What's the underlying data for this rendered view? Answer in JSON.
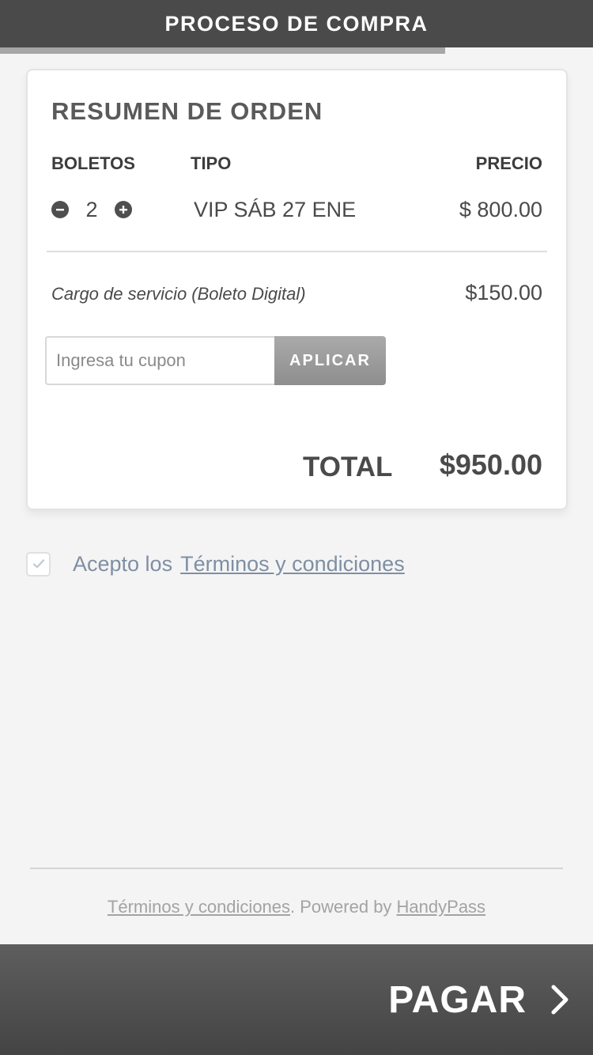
{
  "header": {
    "title": "PROCESO DE COMPRA",
    "progress_fraction": 0.75
  },
  "order": {
    "title": "RESUMEN DE ORDEN",
    "columns": {
      "boletos": "BOLETOS",
      "tipo": "TIPO",
      "precio": "PRECIO"
    },
    "item": {
      "quantity": "2",
      "tipo": "VIP SÁB 27 ENE",
      "precio": "$ 800.00"
    },
    "service_fee": {
      "label": "Cargo de servicio (Boleto Digital)",
      "value": "$150.00"
    },
    "coupon": {
      "placeholder": "Ingresa tu cupon",
      "value": "",
      "apply_label": "APLICAR"
    },
    "total": {
      "label": "TOTAL",
      "value": "$950.00"
    }
  },
  "terms": {
    "accept_text": "Acepto los",
    "link_text": "Términos y condiciones",
    "checked": true
  },
  "footer": {
    "terms_link": "Términos y condiciones",
    "powered_text": ". Powered by ",
    "brand_link": "HandyPass"
  },
  "pay": {
    "label": "PAGAR"
  }
}
